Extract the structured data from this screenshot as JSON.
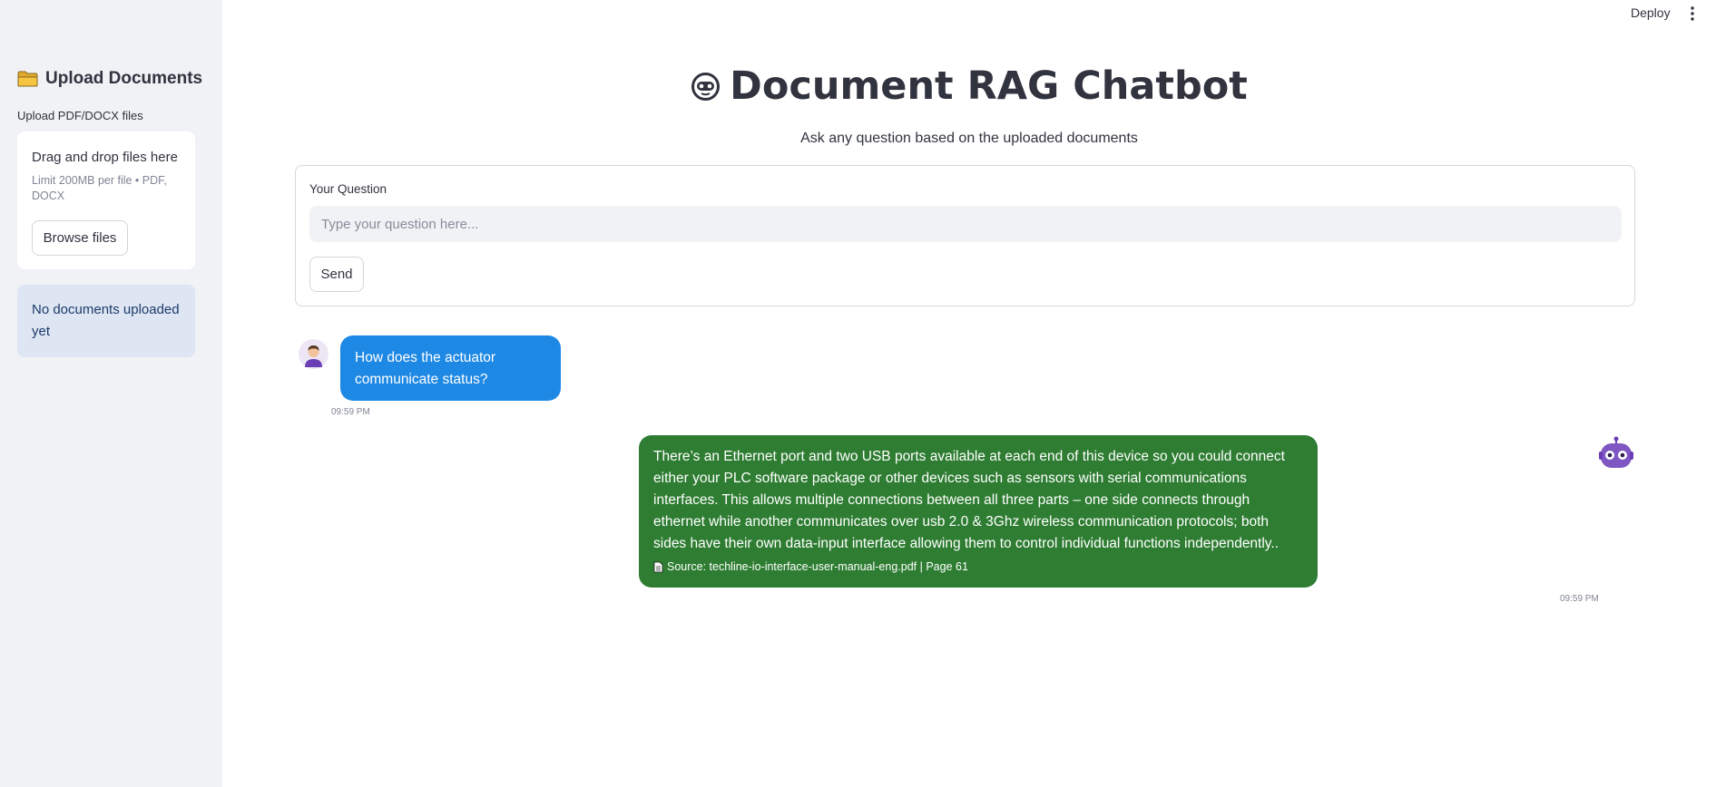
{
  "topbar": {
    "deploy_label": "Deploy",
    "menu_icon": "kebab-menu-icon"
  },
  "sidebar": {
    "header": "Upload Documents",
    "header_icon": "folder-icon",
    "upload_label": "Upload PDF/DOCX files",
    "dropzone": {
      "title": "Drag and drop files here",
      "limit": "Limit 200MB per file • PDF, DOCX",
      "browse_label": "Browse files"
    },
    "info": "No documents uploaded yet"
  },
  "main": {
    "title": "Document RAG Chatbot",
    "title_icon": "robot-face-icon",
    "subtitle": "Ask any question based on the uploaded documents",
    "form": {
      "label": "Your Question",
      "placeholder": "Type your question here...",
      "value": "",
      "send_label": "Send"
    }
  },
  "chat": {
    "messages": [
      {
        "role": "user",
        "text": "How does the actuator communicate status?",
        "time": "09:59 PM",
        "bubble_color": "#1e88e5"
      },
      {
        "role": "bot",
        "text": "There’s an Ethernet port and two USB ports available at each end of this device so you could connect either your PLC software package or other devices such as sensors with serial communications interfaces. This allows multiple connections between all three parts – one side connects through ethernet while another communicates over usb 2.0 & 3Ghz wireless communication protocols; both sides have their own data-input interface allowing them to control individual functions independently..",
        "source": "Source: techline-io-interface-user-manual-eng.pdf | Page 61",
        "time": "09:59 PM",
        "bubble_color": "#2e7d32"
      }
    ]
  },
  "colors": {
    "sidebar_bg": "#f0f2f6",
    "info_bg": "#dde6f2",
    "text": "#31333f"
  }
}
